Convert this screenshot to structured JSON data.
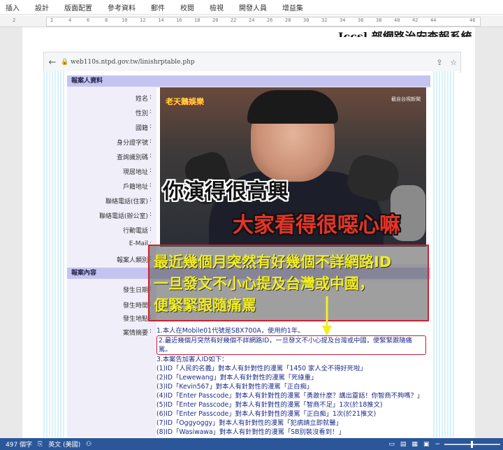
{
  "ribbon": {
    "tabs": [
      "插入",
      "設計",
      "版面配置",
      "參考資料",
      "郵件",
      "校閱",
      "檢視",
      "開發人員",
      "增益集"
    ]
  },
  "ruler": {
    "ticks": [
      "2",
      "2",
      "4",
      "6",
      "8",
      "10",
      "12",
      "14",
      "16",
      "18",
      "20",
      "22",
      "24",
      "26",
      "28",
      "30",
      "32",
      "34",
      "36",
      "38",
      "40",
      "42",
      "44",
      "46"
    ]
  },
  "document": {
    "heading_fragment": "Iccsl 部網路治安查報系統"
  },
  "browser": {
    "url": "web110s.ntpd.gov.tw/linishrptable.php",
    "back_icon": "arrow-left-icon",
    "share_icon": "share-icon",
    "star_icon": "star-icon"
  },
  "form": {
    "reporter_section": "報案人資料",
    "reporter_fields": [
      "姓名",
      "性別",
      "國籍",
      "身分證字號",
      "查詢識別碼",
      "現居地址",
      "戶籍地址",
      "聯絡電話(住家)",
      "聯絡電話(辦公室)",
      "行動電話",
      "E-Mail",
      "報案人類別"
    ],
    "case_section": "報案內容",
    "case_fields": [
      "發生日期",
      "發生時間",
      "發生地點",
      "案情摘要"
    ],
    "summary_lines": [
      "1.本人在Mobile01代號是SBX700A，使用約1年。",
      "2.最近幾個月突然有好幾個不詳網路ID，一旦發文不小心提及台灣或中國，便緊緊跟隨痛罵。",
      "3.本案告加害人ID如下：",
      "(1)ID「人民的名義」對本人有針對性的漫罵「1450 家人全不得好死啦」",
      "(2)ID「Lewewang」對本人有針對性的漫罵「死綠重」",
      "(3)ID「Kevin567」對本人有針對性的漫罵「正白痴」",
      "(4)ID「Enter Passcode」對本人有針對性的漫罵「勇敢什麼？講出靈話！你智商不夠嗎？」",
      "(5)ID「Enter Passcode」對本人有針對性的漫罵「智商不足」1次(於18推文)",
      "(6)ID「Enter Passcode」對本人有針對性的漫罵「正白痴」1次(於21推文)",
      "(7)ID「Oggyoggy」對本人有針對性的漫罵「犯病請立即就醫」",
      "(8)ID「Wasiwawa」對本人有針對性的漫罵「SB別裝沒看到！」"
    ]
  },
  "photo": {
    "logo": "老天鵝娛樂",
    "corner_mark": "截自台視新聞",
    "caption_top": "你演得很高興",
    "caption_bottom": "大家看得很噁心嘛"
  },
  "callout": {
    "lines": [
      "最近幾個月突然有好幾個不詳網路ID",
      "一旦發文不小心提及台灣或中國，",
      "便緊緊跟隨痛罵"
    ],
    "text_color": "#f2ee22",
    "border_color": "#cc2233"
  },
  "statusbar": {
    "word_count": "497 個字",
    "language": "英文 (美國)",
    "background": "#2b579a"
  }
}
